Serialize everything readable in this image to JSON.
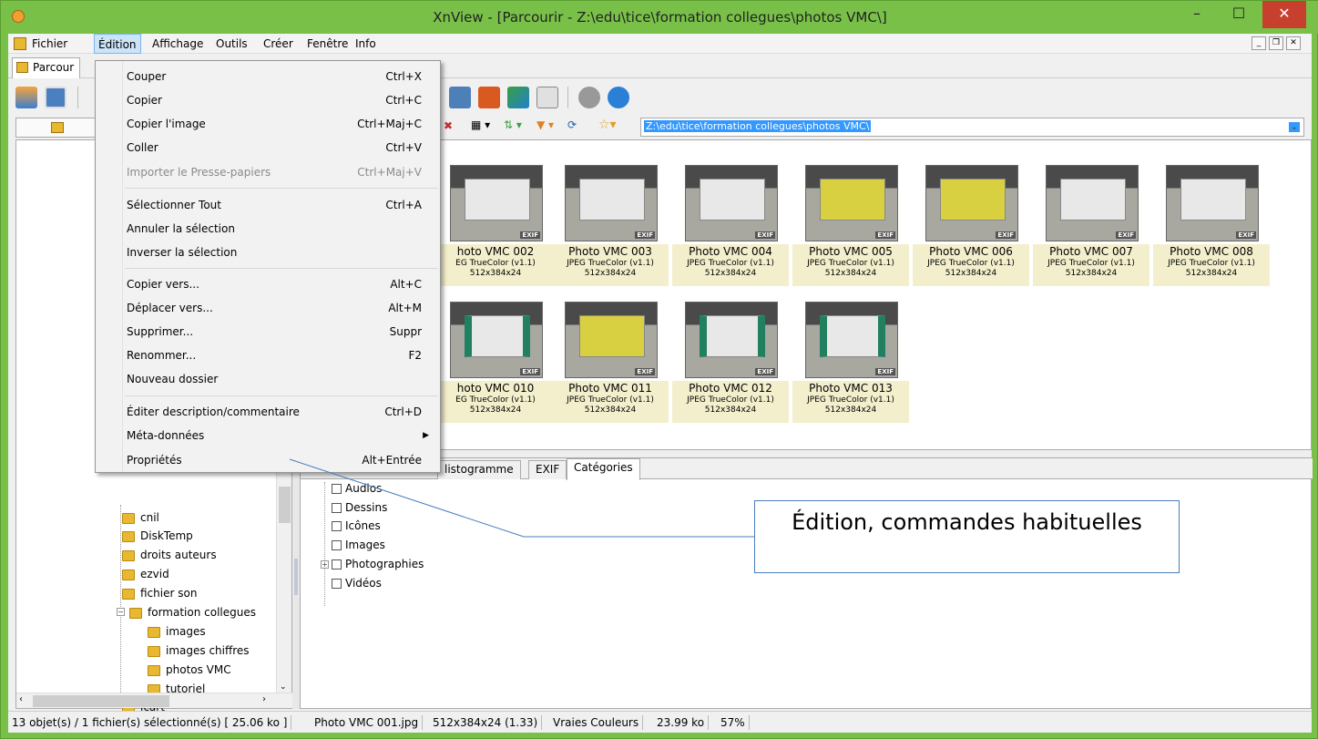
{
  "window": {
    "title": "XnView - [Parcourir - Z:\\edu\\tice\\formation collegues\\photos VMC\\]"
  },
  "menubar": {
    "items": [
      "Fichier",
      "Édition",
      "Affichage",
      "Outils",
      "Créer",
      "Fenêtre",
      "Info"
    ]
  },
  "tab": {
    "label": "Parcour"
  },
  "address": {
    "value": "Z:\\edu\\tice\\formation collegues\\photos VMC\\"
  },
  "tree": {
    "items": [
      "cnil",
      "DiskTemp",
      "droits auteurs",
      "ezvid",
      "fichier son",
      "formation collegues",
      "images",
      "images chiffres",
      "photos VMC",
      "tutoriel",
      "icart"
    ]
  },
  "thumbnails": [
    {
      "name": "hoto VMC 002",
      "type": "EG TrueColor (v1.1)",
      "dims": "512x384x24"
    },
    {
      "name": "Photo VMC 003",
      "type": "JPEG TrueColor (v1.1)",
      "dims": "512x384x24"
    },
    {
      "name": "Photo VMC 004",
      "type": "JPEG TrueColor (v1.1)",
      "dims": "512x384x24"
    },
    {
      "name": "Photo VMC 005",
      "type": "JPEG TrueColor (v1.1)",
      "dims": "512x384x24"
    },
    {
      "name": "Photo VMC 006",
      "type": "JPEG TrueColor (v1.1)",
      "dims": "512x384x24"
    },
    {
      "name": "Photo VMC 007",
      "type": "JPEG TrueColor (v1.1)",
      "dims": "512x384x24"
    },
    {
      "name": "Photo VMC 008",
      "type": "JPEG TrueColor (v1.1)",
      "dims": "512x384x24"
    },
    {
      "name": "hoto VMC 010",
      "type": "EG TrueColor (v1.1)",
      "dims": "512x384x24"
    },
    {
      "name": "Photo VMC 011",
      "type": "JPEG TrueColor (v1.1)",
      "dims": "512x384x24"
    },
    {
      "name": "Photo VMC 012",
      "type": "JPEG TrueColor (v1.1)",
      "dims": "512x384x24"
    },
    {
      "name": "Photo VMC 013",
      "type": "JPEG TrueColor (v1.1)",
      "dims": "512x384x24"
    }
  ],
  "exif_badge": "EXIF",
  "bottom_tabs": [
    "listogramme",
    "EXIF",
    "Catégories"
  ],
  "categories": [
    "Audios",
    "Dessins",
    "Icônes",
    "Images",
    "Photographies",
    "Vidéos"
  ],
  "edit_menu": {
    "items": [
      {
        "label": "Couper",
        "shortcut": "Ctrl+X"
      },
      {
        "label": "Copier",
        "shortcut": "Ctrl+C"
      },
      {
        "label": "Copier l'image",
        "shortcut": "Ctrl+Maj+C"
      },
      {
        "label": "Coller",
        "shortcut": "Ctrl+V"
      },
      {
        "label": "Importer le Presse-papiers",
        "shortcut": "Ctrl+Maj+V"
      },
      {
        "label": "Sélectionner Tout",
        "shortcut": "Ctrl+A"
      },
      {
        "label": "Annuler la sélection",
        "shortcut": ""
      },
      {
        "label": "Inverser la sélection",
        "shortcut": ""
      },
      {
        "label": "Copier vers...",
        "shortcut": "Alt+C"
      },
      {
        "label": "Déplacer vers...",
        "shortcut": "Alt+M"
      },
      {
        "label": "Supprimer...",
        "shortcut": "Suppr"
      },
      {
        "label": "Renommer...",
        "shortcut": "F2"
      },
      {
        "label": "Nouveau dossier",
        "shortcut": ""
      },
      {
        "label": "Éditer description/commentaire",
        "shortcut": "Ctrl+D"
      },
      {
        "label": "Méta-données",
        "shortcut": ""
      },
      {
        "label": "Propriétés",
        "shortcut": "Alt+Entrée"
      }
    ]
  },
  "status": {
    "selection": "13 objet(s) / 1 fichier(s) sélectionné(s)  [ 25.06 ko ]",
    "filename": "Photo VMC 001.jpg",
    "dims": "512x384x24 (1.33)",
    "colors": "Vraies Couleurs",
    "size": "23.99 ko",
    "zoom": "57%"
  },
  "callout": {
    "text": "Édition, commandes habituelles"
  },
  "colors": {
    "titlebar": "#78c048",
    "accent": "#3399ff",
    "close": "#c7402d"
  }
}
